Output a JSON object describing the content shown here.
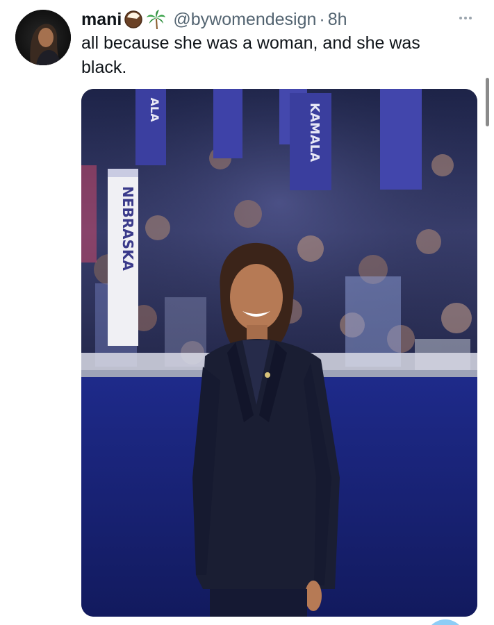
{
  "tweet": {
    "display_name": "mani",
    "emojis": [
      "coconut-icon",
      "palm-tree-icon"
    ],
    "handle": "@bywomendesign",
    "separator": "·",
    "time": "8h",
    "text": "all because she was a woman, and she was black.",
    "more_icon": "more-horizontal-icon"
  },
  "media": {
    "signs": {
      "state_sign": "NEBRASKA",
      "name_sign": "KAMALA",
      "short_sign": "ALA"
    }
  },
  "colors": {
    "text_primary": "#0f1419",
    "text_secondary": "#536471",
    "accent": "#1d9bf0"
  }
}
